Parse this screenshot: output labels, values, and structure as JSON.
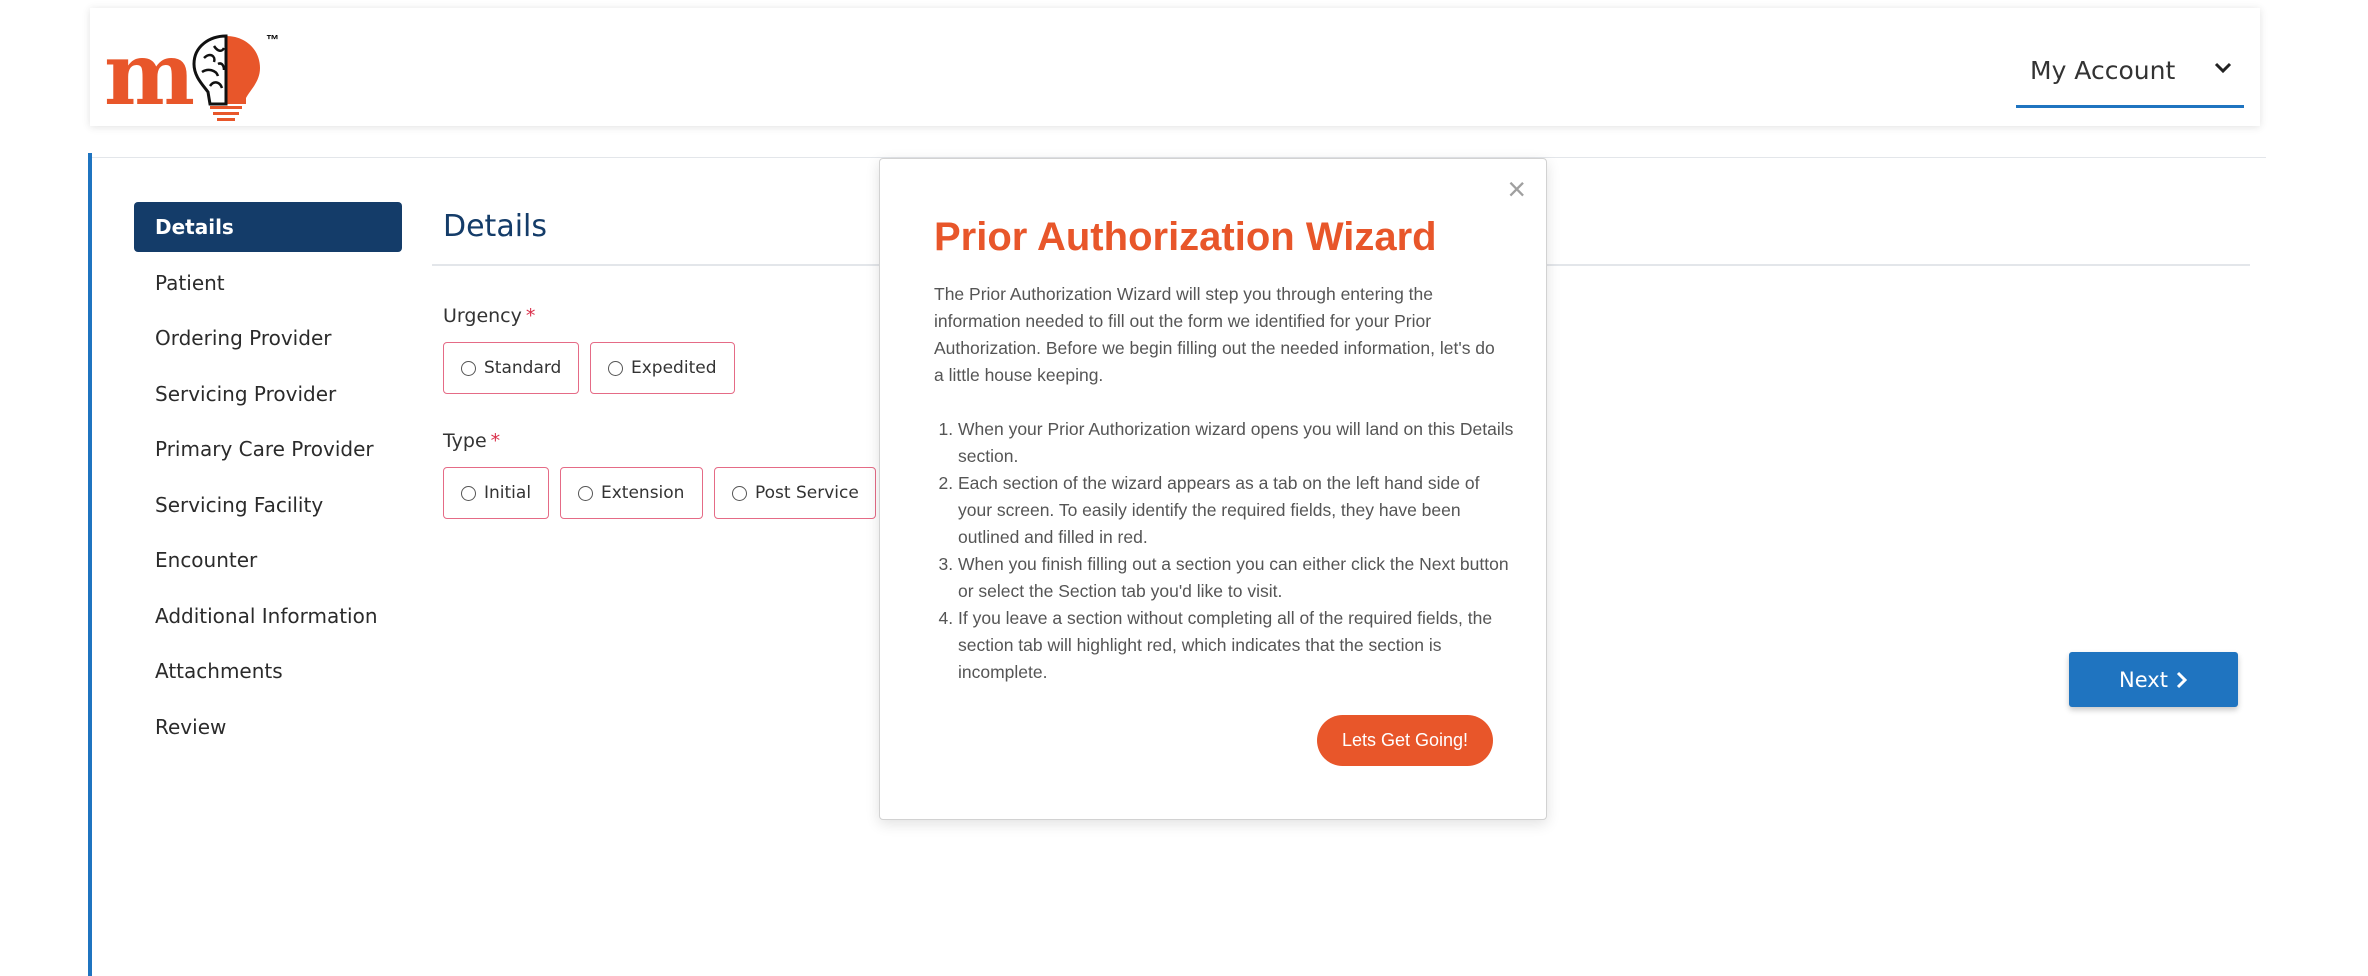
{
  "brand": {
    "logo_letter": "m",
    "trademark": "™",
    "accent_color": "#e8562a"
  },
  "header": {
    "account_label": "My Account",
    "account_icon": "chevron-down-icon"
  },
  "sidebar": {
    "items": [
      {
        "label": "Details",
        "active": true
      },
      {
        "label": "Patient",
        "active": false
      },
      {
        "label": "Ordering Provider",
        "active": false
      },
      {
        "label": "Servicing Provider",
        "active": false
      },
      {
        "label": "Primary Care Provider",
        "active": false
      },
      {
        "label": "Servicing Facility",
        "active": false
      },
      {
        "label": "Encounter",
        "active": false
      },
      {
        "label": "Additional Information",
        "active": false
      },
      {
        "label": "Attachments",
        "active": false
      },
      {
        "label": "Review",
        "active": false
      }
    ],
    "active_color": "#143c69"
  },
  "content": {
    "title": "Details",
    "urgency": {
      "label": "Urgency",
      "required_mark": "*",
      "options": [
        "Standard",
        "Expedited"
      ]
    },
    "type": {
      "label": "Type",
      "required_mark": "*",
      "options": [
        "Initial",
        "Extension",
        "Post Service"
      ]
    },
    "next_label": "Next",
    "next_icon": "chevron-right-icon",
    "primary_color": "#1f74c0",
    "required_color": "#e56b86"
  },
  "modal": {
    "close_glyph": "×",
    "title": "Prior Authorization Wizard",
    "intro": "The Prior Authorization Wizard will step you through entering the information needed to fill out the form we identified for your Prior Authorization. Before we begin filling out the needed information, let's do a little house keeping.",
    "steps": [
      "When your Prior Authorization wizard opens you will land on this Details section.",
      "Each section of the wizard appears as a tab on the left hand side of your screen. To easily identify the required fields, they have been outlined and filled in red.",
      "When you finish filling out a section you can either click the Next button or select the Section tab you'd like to visit.",
      "If you leave a section without completing all of the required fields, the section tab will highlight red, which indicates that the section is incomplete."
    ],
    "cta_label": "Lets Get Going!"
  }
}
